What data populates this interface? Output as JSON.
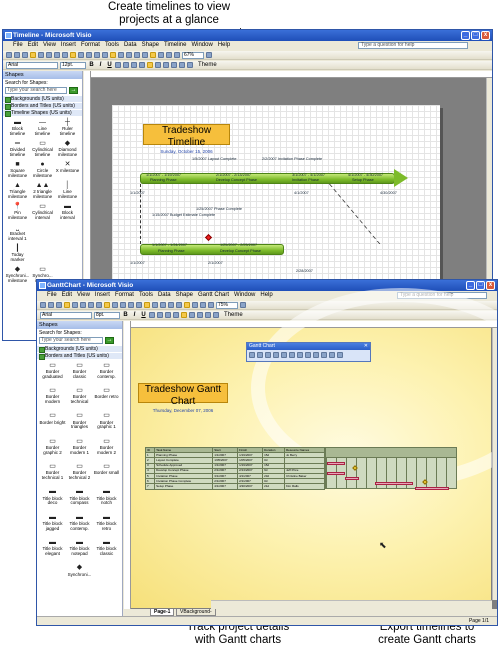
{
  "callouts": {
    "top": "Create timelines to view projects at a glance",
    "bottom_left": "Track project details with Gantt charts",
    "bottom_right": "Export timelines to create Gantt charts"
  },
  "visio": {
    "title": "Timeline - Microsoft Visio",
    "menu": [
      "File",
      "Edit",
      "View",
      "Insert",
      "Format",
      "Tools",
      "Data",
      "Shape",
      "Timeline",
      "Window",
      "Help"
    ],
    "ask_placeholder": "Type a question for help",
    "font": "Arial",
    "font_size": "12pt.",
    "zoom": "67%",
    "theme": "Theme",
    "shapes_panel": {
      "title": "Shapes",
      "search_label": "Search for Shapes:",
      "search_placeholder": "Type your search here",
      "stencils": [
        "Backgrounds (US units)",
        "Borders and Titles (US units)",
        "Timeline Shapes (US units)"
      ],
      "items": [
        "Block timeline",
        "Line timeline",
        "Ruler timeline",
        "Divided timeline",
        "Cylindrical timeline",
        "Diamond milestone",
        "Square milestone",
        "Circle milestone",
        "X milestone",
        "Triangle milestone",
        "2 triangle milestone",
        "Line milestone",
        "Pin milestone",
        "Cylindrical interval",
        "Block interval",
        "Bracket interval 1",
        "",
        "",
        "Today marker",
        "",
        "",
        "Synchroni... milestone",
        "Synchro... interval",
        ""
      ]
    },
    "timeline": {
      "title": "Tradeshow Timeline",
      "date": "Sunday, October 15, 2006",
      "milestones": [
        "1/5/2007 Layout Complete",
        "2/2/2007 Invitation Phase Complete",
        "1/15/2007 Budget Estimate Complete",
        "1/25/2007 Phase Complete"
      ],
      "phases": [
        "Planning Phase",
        "Develop Concept Phase",
        "Invitation Phase",
        "Setup Phase"
      ],
      "dates": [
        "1/1/2007",
        "1/1/2007 - 1/19/2007",
        "2/1/2007 - 2/13/2007",
        "3/1/2007 - 4/1/2007",
        "4/1/2007 - 4/30/2007",
        "4/30/2007",
        "1/1/2007",
        "1/1/2007 - 1/24/2007",
        "1/25/2007 - 2/25/2007",
        "2/1/2007",
        "2/28/2007",
        "4/1/2007"
      ]
    }
  },
  "gantt": {
    "title": "GanttChart - Microsoft Visio",
    "menu": [
      "File",
      "Edit",
      "View",
      "Insert",
      "Format",
      "Tools",
      "Data",
      "Shape",
      "Gantt Chart",
      "Window",
      "Help"
    ],
    "ask_placeholder": "Type a question for help",
    "font": "Arial",
    "font_size": "8pt.",
    "zoom": "75%",
    "theme": "Theme",
    "shapes_panel": {
      "title": "Shapes",
      "search_label": "Search for Shapes:",
      "search_placeholder": "Type your search here",
      "stencils": [
        "Backgrounds (US units)",
        "Borders and Titles (US units)"
      ],
      "items": [
        "Border graduated",
        "Border classic",
        "Border contemp.",
        "Border modern",
        "Border technical",
        "Border retro",
        "Border bright",
        "Border triangles",
        "Border graphic 1",
        "Border graphic 2",
        "Border modern 1",
        "Border modern 2",
        "Border technical 1",
        "Border technical 2",
        "Border small",
        "Title block deco",
        "Title block compass",
        "Title block notch",
        "Title block jagged",
        "Title block contemp.",
        "Title block retro",
        "Title block elegant",
        "Title block notepad",
        "Title block classic",
        "",
        "Synchroni...",
        ""
      ],
      "footer_stencil": "Gantt Chart Shapes (US units)"
    },
    "chart": {
      "title": "Tradeshow Gantt Chart",
      "date": "Thursday, December 07, 2006",
      "columns": [
        "ID",
        "Task Name",
        "Start",
        "Finish",
        "Duration",
        "Resource Names"
      ],
      "rows": [
        [
          "1",
          "Planning Phase",
          "1/1/2007",
          "1/19/2007",
          "15d",
          "Jo Berry"
        ],
        [
          "2",
          "Layout Complete",
          "1/05/2007",
          "1/05/2007",
          "0d",
          ""
        ],
        [
          "3",
          "Schedule Approved",
          "1/1/2007",
          "1/19/2007",
          "15d",
          ""
        ],
        [
          "4",
          "Develop Concept Phase",
          "2/1/2007",
          "2/13/2007",
          "9d",
          "Jeff Price"
        ],
        [
          "5",
          "Invitation Phase",
          "3/1/2007",
          "4/1/2007",
          "23d",
          "Christine Baker"
        ],
        [
          "6",
          "Invitation Phase Complete",
          "2/1/2007",
          "2/1/2007",
          "0d",
          ""
        ],
        [
          "7",
          "Setup Phase",
          "4/1/2007",
          "4/30/2007",
          "21d",
          "Kim Ralls"
        ]
      ]
    },
    "gantt_toolbar_title": "Gantt Chart",
    "page_tabs": [
      "Page-1",
      "VBackground-1"
    ],
    "status": "Page 1/1"
  }
}
